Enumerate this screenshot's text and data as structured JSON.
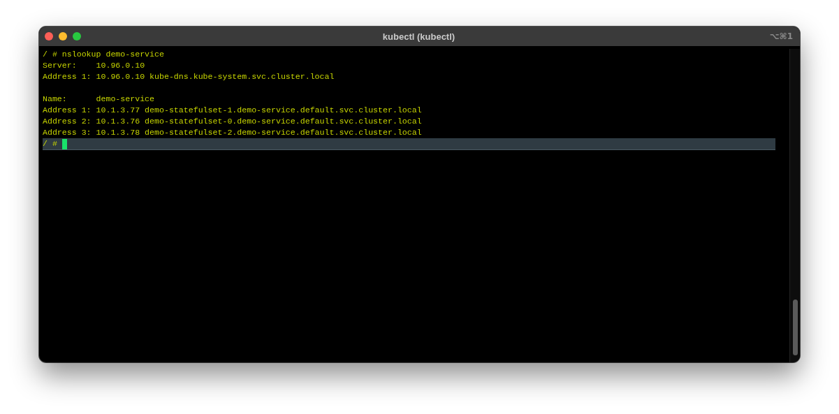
{
  "window": {
    "title": "kubectl (kubectl)",
    "shortcut": "⌥⌘1"
  },
  "terminal": {
    "blocks": [
      [
        "/ # nslookup demo-service",
        "Server:    10.96.0.10",
        "Address 1: 10.96.0.10 kube-dns.kube-system.svc.cluster.local"
      ],
      [
        "Name:      demo-service",
        "Address 1: 10.1.3.77 demo-statefulset-1.demo-service.default.svc.cluster.local",
        "Address 2: 10.1.3.76 demo-statefulset-0.demo-service.default.svc.cluster.local",
        "Address 3: 10.1.3.78 demo-statefulset-2.demo-service.default.svc.cluster.local"
      ]
    ],
    "prompt": "/ #"
  }
}
